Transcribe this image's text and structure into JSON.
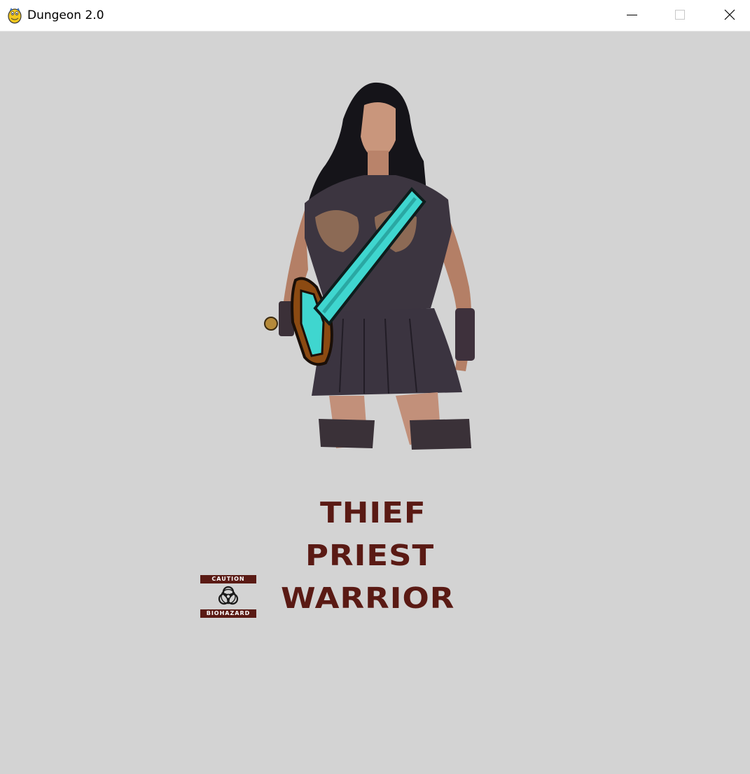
{
  "window": {
    "title": "Dungeon 2.0",
    "icon": "python-pygame-icon",
    "controls": [
      "minimize-icon",
      "maximize-icon",
      "close-icon"
    ]
  },
  "colors": {
    "background": "#d3d3d3",
    "menu_text": "#5a1a14",
    "sword_blade": "#3fd6cf",
    "sword_hilt": "#8b4a12"
  },
  "menu": {
    "items": [
      "THIEF",
      "PRIEST",
      "WARRIOR"
    ],
    "selected": "WARRIOR"
  },
  "selector": {
    "top_label": "CAUTION",
    "bottom_label": "BIOHAZARD",
    "icon": "biohazard-icon"
  },
  "character": {
    "icon": "warrior-woman-with-diamond-sword"
  }
}
